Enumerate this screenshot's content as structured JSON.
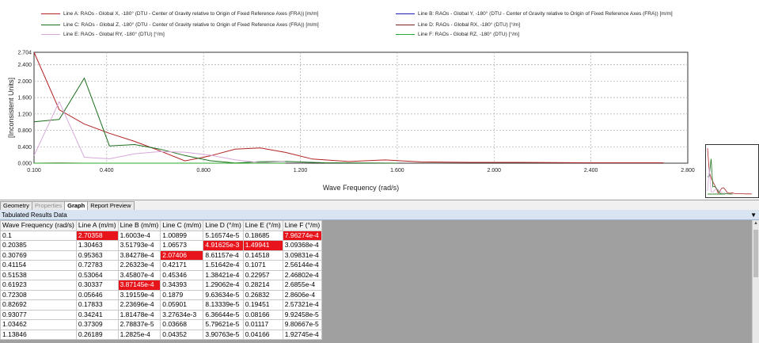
{
  "legend": [
    {
      "label": "Line A: RAOs - Global X, -180° (DTU - Center of Gravity relative to Origin of Fixed Reference Axes (FRA)) [m/m]",
      "color": "#b22222"
    },
    {
      "label": "Line B: RAOs - Global Y, -180° (DTU - Center of Gravity relative to Origin of Fixed Reference Axes (FRA)) [m/m]",
      "color": "#1f1fb4"
    },
    {
      "label": "Line C: RAOs - Global Z, -180° (DTU - Center of Gravity relative to Origin of Fixed Reference Axes (FRA)) [m/m]",
      "color": "#1a6e1a"
    },
    {
      "label": "Line D: RAOs - Global RX, -180° (DTU) [°/m]",
      "color": "#7a2020"
    },
    {
      "label": "Line E: RAOs - Global RY, -180° (DTU) [°/m]",
      "color": "#d8a8d8"
    },
    {
      "label": "Line F: RAOs - Global RZ, -180° (DTU) [°/m]",
      "color": "#2ea82e"
    }
  ],
  "tabs": [
    {
      "label": "Geometry",
      "state": "normal"
    },
    {
      "label": "Properties",
      "state": "disabled"
    },
    {
      "label": "Graph",
      "state": "active"
    },
    {
      "label": "Report Preview",
      "state": "normal"
    }
  ],
  "panel": {
    "title": "Tabulated Results Data",
    "pin_icon": "pin-icon"
  },
  "table": {
    "headers": [
      "Wave Frequency (rad/s)",
      "Line A (m/m)",
      "Line B (m/m)",
      "Line C (m/m)",
      "Line D (°/m)",
      "Line E (°/m)",
      "Line F (°/m)"
    ],
    "rows": [
      [
        "0.1",
        "2.70358",
        "1.6003e-4",
        "1.00899",
        "5.16574e-5",
        "0.18685",
        "7.96274e-4"
      ],
      [
        "0.20385",
        "1.30463",
        "3.51793e-4",
        "1.06573",
        "4.91625e-3",
        "1.49941",
        "3.09368e-4"
      ],
      [
        "0.30769",
        "0.95363",
        "3.84278e-4",
        "2.07406",
        "8.61157e-4",
        "0.14518",
        "3.09831e-4"
      ],
      [
        "0.41154",
        "0.72783",
        "2.26323e-4",
        "0.42171",
        "1.51642e-4",
        "0.1071",
        "2.56144e-4"
      ],
      [
        "0.51538",
        "0.53064",
        "3.45807e-4",
        "0.45346",
        "1.38421e-4",
        "0.22957",
        "2.46802e-4"
      ],
      [
        "0.61923",
        "0.30337",
        "3.87145e-4",
        "0.34393",
        "1.29062e-4",
        "0.28214",
        "2.6855e-4"
      ],
      [
        "0.72308",
        "0.05646",
        "3.19159e-4",
        "0.1879",
        "9.63634e-5",
        "0.26832",
        "2.8606e-4"
      ],
      [
        "0.82692",
        "0.17833",
        "2.23696e-4",
        "0.05901",
        "8.13339e-5",
        "0.19451",
        "2.57321e-4"
      ],
      [
        "0.93077",
        "0.34241",
        "1.81478e-4",
        "3.27634e-3",
        "6.36644e-5",
        "0.08166",
        "9.92458e-5"
      ],
      [
        "1.03462",
        "0.37309",
        "2.78837e-5",
        "0.03668",
        "5.79621e-5",
        "0.01117",
        "9.80667e-5"
      ],
      [
        "1.13846",
        "0.26189",
        "1.2825e-4",
        "0.04352",
        "3.90763e-5",
        "0.04166",
        "1.92745e-4"
      ]
    ],
    "highlights": [
      [
        0,
        1
      ],
      [
        0,
        6
      ],
      [
        1,
        4
      ],
      [
        1,
        5
      ],
      [
        2,
        3
      ],
      [
        5,
        2
      ]
    ],
    "highlight_color": "#e8141c"
  },
  "chart_data": {
    "type": "line",
    "xlabel": "Wave Frequency (rad/s)",
    "ylabel": "[Inconsistent Units]",
    "xlim": [
      0.1,
      2.8
    ],
    "ylim": [
      0,
      2.704
    ],
    "xticks": [
      "0.100",
      "0.400",
      "0.800",
      "1.200",
      "1.600",
      "2.000",
      "2.400",
      "2.800"
    ],
    "xtick_values": [
      0.1,
      0.4,
      0.8,
      1.2,
      1.6,
      2.0,
      2.4,
      2.8
    ],
    "yticks": [
      "0.000",
      "0.400",
      "0.800",
      "1.200",
      "1.600",
      "2.000",
      "2.400",
      "2.704"
    ],
    "ytick_values": [
      0,
      0.4,
      0.8,
      1.2,
      1.6,
      2.0,
      2.4,
      2.704
    ],
    "grid": true,
    "series": [
      {
        "name": "Line A",
        "color": "#b22222",
        "x": [
          0.1,
          0.20385,
          0.30769,
          0.41154,
          0.51538,
          0.61923,
          0.72308,
          0.82692,
          0.93077,
          1.03462,
          1.13846,
          1.25,
          1.4,
          1.55,
          1.7,
          1.9,
          2.1,
          2.4,
          2.7
        ],
        "y": [
          2.70358,
          1.30463,
          0.95363,
          0.72783,
          0.53064,
          0.30337,
          0.05646,
          0.17833,
          0.34241,
          0.37309,
          0.26189,
          0.1,
          0.04,
          0.08,
          0.03,
          0.02,
          0.02,
          0.01,
          0.01
        ]
      },
      {
        "name": "Line B",
        "color": "#1f1fb4",
        "x": [
          0.1,
          0.20385,
          0.30769,
          0.41154,
          0.51538,
          0.61923,
          0.72308,
          0.82692,
          0.93077,
          1.03462,
          1.13846
        ],
        "y": [
          0.00016,
          0.00035,
          0.00038,
          0.00023,
          0.00035,
          0.00039,
          0.00032,
          0.00022,
          0.00018,
          3e-05,
          0.00013
        ]
      },
      {
        "name": "Line C",
        "color": "#1a6e1a",
        "x": [
          0.1,
          0.20385,
          0.30769,
          0.41154,
          0.51538,
          0.61923,
          0.72308,
          0.82692,
          0.93077,
          1.03462,
          1.13846,
          1.3,
          1.6
        ],
        "y": [
          1.00899,
          1.06573,
          2.07406,
          0.42171,
          0.45346,
          0.34393,
          0.1879,
          0.05901,
          0.00328,
          0.03668,
          0.04352,
          0.01,
          0.0
        ]
      },
      {
        "name": "Line D",
        "color": "#7a2020",
        "x": [
          0.1,
          0.20385,
          0.30769,
          0.41154,
          0.51538,
          0.61923,
          0.72308,
          0.82692,
          0.93077,
          1.03462,
          1.13846
        ],
        "y": [
          5e-05,
          0.00492,
          0.00086,
          0.00015,
          0.00014,
          0.00013,
          0.0001,
          8e-05,
          6e-05,
          6e-05,
          4e-05
        ]
      },
      {
        "name": "Line E",
        "color": "#d8a8d8",
        "x": [
          0.1,
          0.20385,
          0.30769,
          0.41154,
          0.51538,
          0.61923,
          0.72308,
          0.82692,
          0.93077,
          1.03462,
          1.13846
        ],
        "y": [
          0.18685,
          1.49941,
          0.14518,
          0.1071,
          0.22957,
          0.28214,
          0.26832,
          0.19451,
          0.08166,
          0.01117,
          0.04166
        ]
      },
      {
        "name": "Line F",
        "color": "#2ea82e",
        "x": [
          0.1,
          0.20385,
          0.30769,
          0.41154,
          0.51538,
          0.61923,
          0.72308,
          0.82692,
          0.93077,
          1.03462,
          1.13846
        ],
        "y": [
          0.0008,
          0.00031,
          0.00031,
          0.00026,
          0.00025,
          0.00027,
          0.00029,
          0.00026,
          0.0001,
          0.0001,
          0.00019
        ]
      }
    ]
  }
}
